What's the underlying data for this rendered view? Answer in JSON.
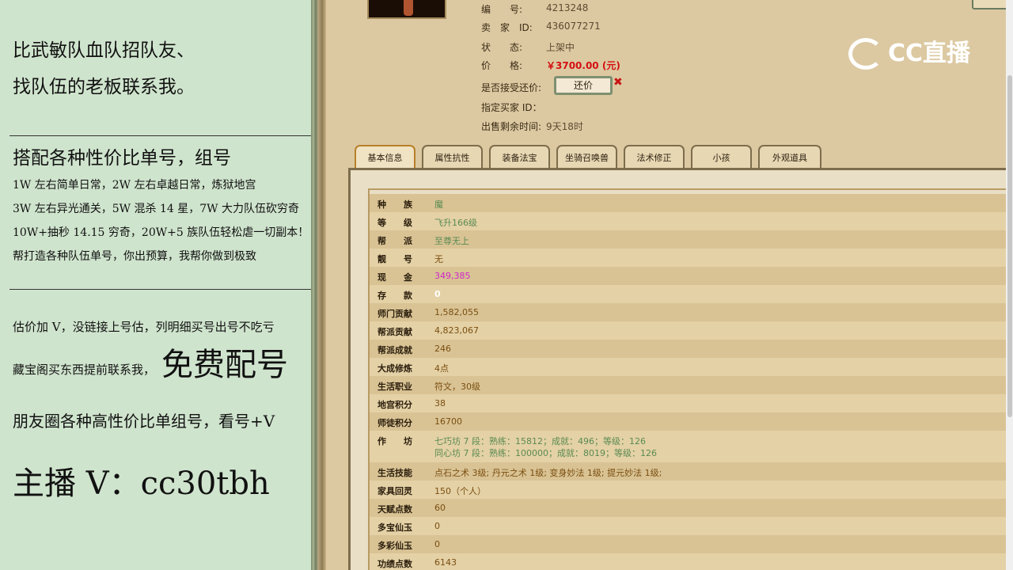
{
  "left_panel": {
    "line1": "比武敏队血队招队友、",
    "line2": "找队伍的老板联系我。",
    "heading2": "搭配各种性价比单号，组号",
    "lines_small": [
      "1W 左右简单日常，2W 左右卓越日常，炼狱地宫",
      "3W 左右异光通关，5W 混杀 14 星，7W 大力队伍砍穷奇",
      "10W+抽秒 14.15 穷奇，20W+5 族队伍轻松虐一切副本！",
      "帮打造各种队伍单号，你出预算，我帮你做到极致"
    ],
    "estimate": "估价加 V，没链接上号估，列明细买号出号不吃亏",
    "treasure": "藏宝阁买东西提前联系我，",
    "free_match": "免费配号",
    "friends": "朋友圈各种高性价比单组号，看号+V",
    "anchor": "主播 V：cc30tbh"
  },
  "logo": {
    "text": "CC直播"
  },
  "listing": {
    "id_label": "编　　号:",
    "id_value": "4213248",
    "seller_label": "卖　家　ID:",
    "seller_value": "436077271",
    "status_label": "状　　态:",
    "status_value": "上架中",
    "price_label": "价　　格:",
    "price_value": "￥3700.00 (元)",
    "counter_label": "是否接受还价:",
    "counter_button": "还价",
    "counter_x": "✖",
    "buyer_label": "指定买家 ID：",
    "time_label": "出售剩余时间:",
    "time_value": "9天18时"
  },
  "tabs": [
    "基本信息",
    "属性抗性",
    "装备法宝",
    "坐骑召唤兽",
    "法术修正",
    "小孩",
    "外观道具"
  ],
  "active_tab": "基本信息",
  "rows": [
    {
      "k": "种　　族",
      "v": "魔"
    },
    {
      "k": "等　　级",
      "v": "飞升166级"
    },
    {
      "k": "帮　　派",
      "v": "至尊无上"
    },
    {
      "k": "靓　　号",
      "v": "无"
    },
    {
      "k": "现　　金",
      "v": "349,385"
    },
    {
      "k": "存　　款",
      "v": "0"
    },
    {
      "k": "师门贡献",
      "v": "1,582,055"
    },
    {
      "k": "帮派贡献",
      "v": "4,823,067"
    },
    {
      "k": "帮派成就",
      "v": "246"
    },
    {
      "k": "大成修炼",
      "v": "4点"
    },
    {
      "k": "生活职业",
      "v": "符文，30级"
    },
    {
      "k": "地宫积分",
      "v": "38"
    },
    {
      "k": "师徒积分",
      "v": "16700"
    },
    {
      "k": "作　　坊",
      "v": "七巧坊 7 段：熟练：15812；成就：496；等级：126",
      "v2": "同心坊 7 段：熟练：100000；成就：8019；等级：126"
    },
    {
      "k": "生活技能",
      "v": "点石之术 3级; 丹元之术 1级; 变身妙法 1级; 提元妙法 1级;"
    },
    {
      "k": "家具回灵",
      "v": "150（个人）"
    },
    {
      "k": "天赋点数",
      "v": "60"
    },
    {
      "k": "多宝仙玉",
      "v": "0"
    },
    {
      "k": "多彩仙玉",
      "v": "0"
    },
    {
      "k": "功绩点数",
      "v": "6143"
    }
  ]
}
